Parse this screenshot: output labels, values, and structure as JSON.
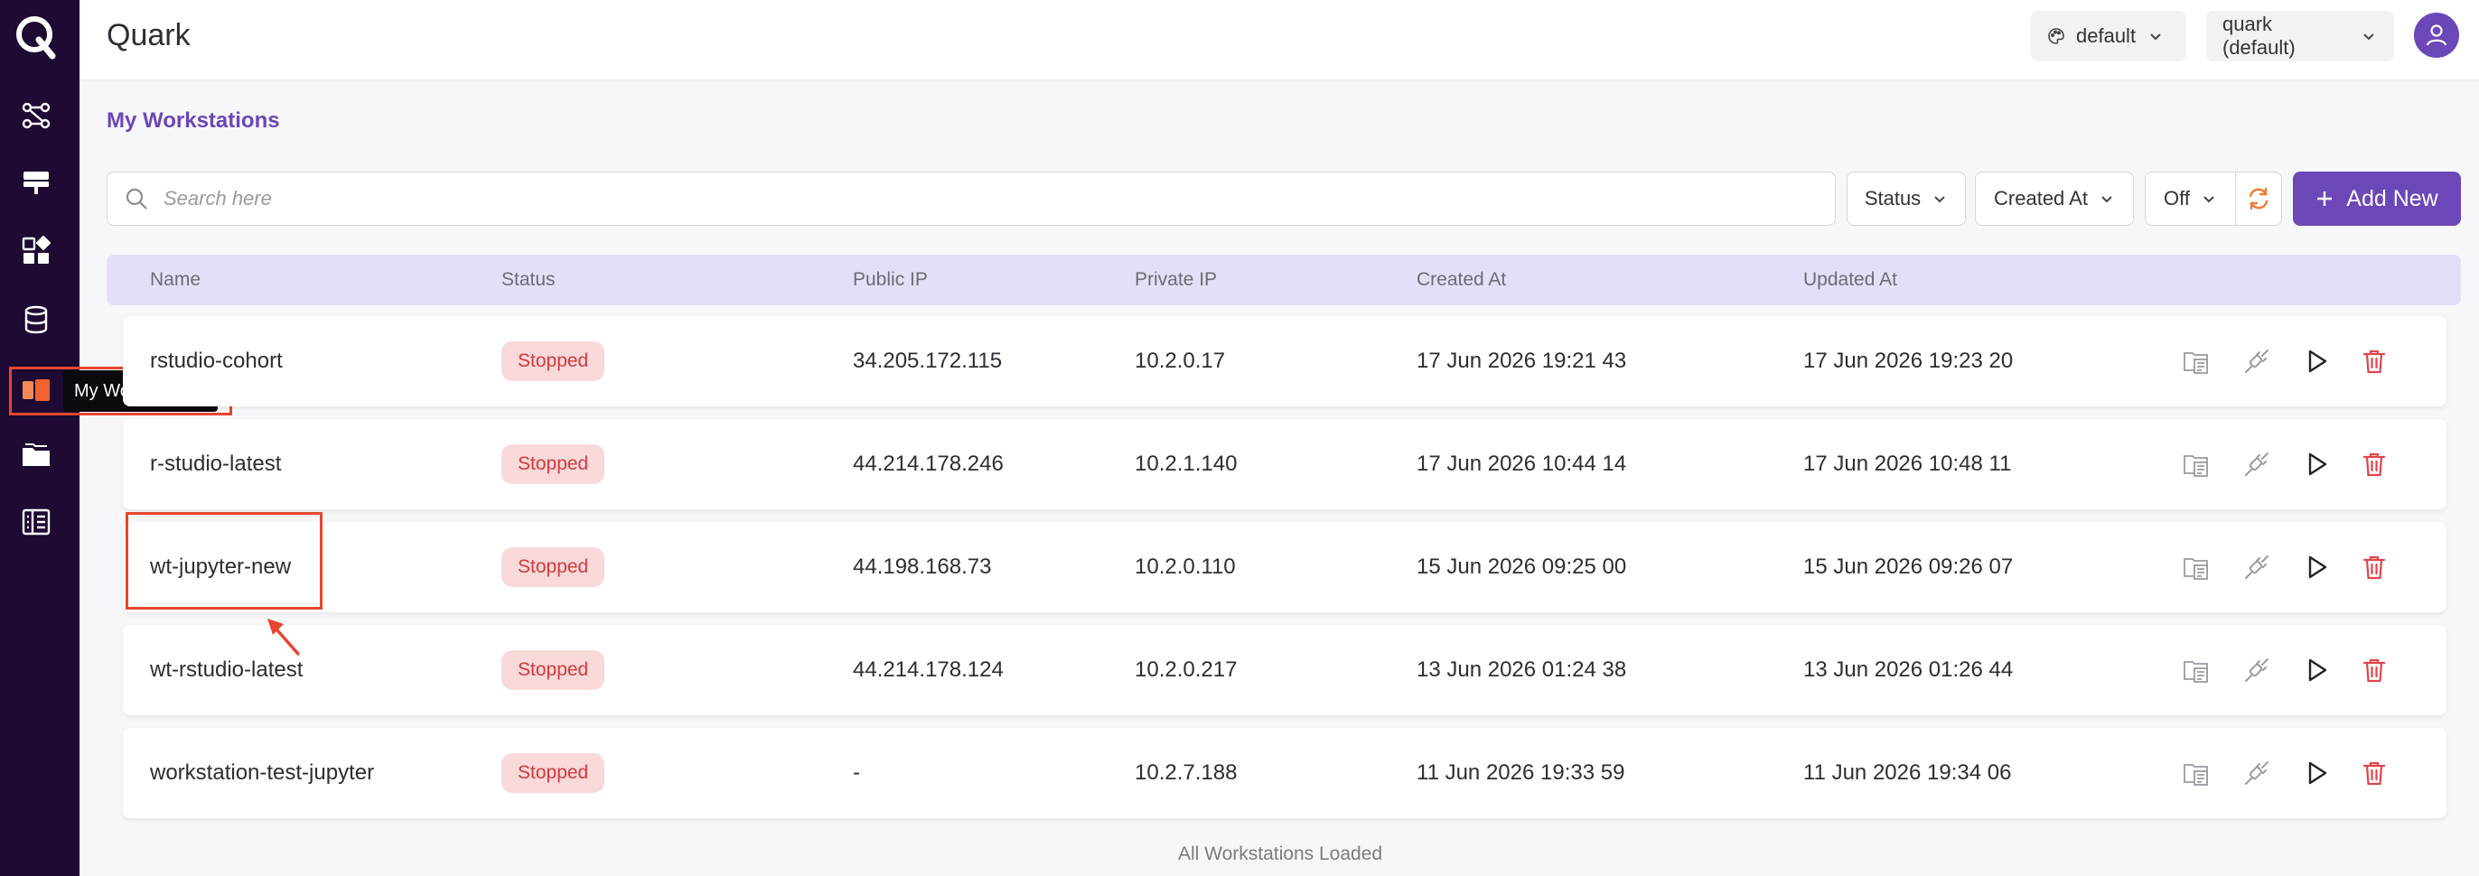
{
  "app": {
    "title": "Quark"
  },
  "sidebar": {
    "logo": "Q",
    "items": [
      {
        "icon": "workflow-icon"
      },
      {
        "icon": "server-icon"
      },
      {
        "icon": "apps-icon"
      },
      {
        "icon": "database-icon"
      },
      {
        "icon": "workstation-icon",
        "active": true
      },
      {
        "icon": "folder-icon"
      },
      {
        "icon": "notebook-icon"
      }
    ],
    "tooltip": "My Workstations"
  },
  "header": {
    "theme_label": "default",
    "workspace_label": "quark (default)"
  },
  "page": {
    "heading": "My Workstations"
  },
  "toolbar": {
    "search_placeholder": "Search here",
    "status_filter": "Status",
    "sort_filter": "Created At",
    "auto_refresh": "Off",
    "add_label": "Add New"
  },
  "table": {
    "columns": [
      "Name",
      "Status",
      "Public IP",
      "Private IP",
      "Created At",
      "Updated At"
    ],
    "rows": [
      {
        "name": "rstudio-cohort",
        "status": "Stopped",
        "public_ip": "34.205.172.115",
        "private_ip": "10.2.0.17",
        "created_at": "17 Jun 2026 19:21 43",
        "updated_at": "17 Jun 2026 19:23 20"
      },
      {
        "name": "r-studio-latest",
        "status": "Stopped",
        "public_ip": "44.214.178.246",
        "private_ip": "10.2.1.140",
        "created_at": "17 Jun 2026 10:44 14",
        "updated_at": "17 Jun 2026 10:48 11"
      },
      {
        "name": "wt-jupyter-new",
        "status": "Stopped",
        "public_ip": "44.198.168.73",
        "private_ip": "10.2.0.110",
        "created_at": "15 Jun 2026 09:25 00",
        "updated_at": "15 Jun 2026 09:26 07"
      },
      {
        "name": "wt-rstudio-latest",
        "status": "Stopped",
        "public_ip": "44.214.178.124",
        "private_ip": "10.2.0.217",
        "created_at": "13 Jun 2026 01:24 38",
        "updated_at": "13 Jun 2026 01:26 44"
      },
      {
        "name": "workstation-test-jupyter",
        "status": "Stopped",
        "public_ip": "-",
        "private_ip": "10.2.7.188",
        "created_at": "11 Jun 2026 19:33 59",
        "updated_at": "11 Jun 2026 19:34 06"
      }
    ],
    "footer": "All Workstations Loaded"
  },
  "colors": {
    "sidebar_bg": "#1e0a33",
    "accent": "#6b47b8",
    "stopped_bg": "#f9d9d9",
    "stopped_text": "#d2393c",
    "annotation": "#e5462e",
    "refresh": "#f07a2e",
    "delete": "#e0444b"
  }
}
